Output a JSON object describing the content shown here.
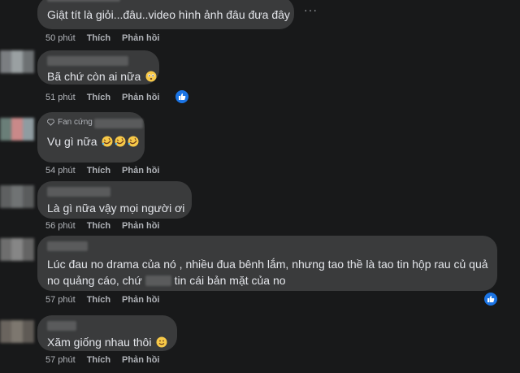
{
  "actions": {
    "like": "Thích",
    "reply": "Phản hồi"
  },
  "more_menu": "···",
  "comments": [
    {
      "text": "Giật tít là giỏi...đâu..video hình ảnh đâu đưa đây",
      "time": "50 phút"
    },
    {
      "text": "Bã chứ còn ai nữa",
      "time": "51 phút"
    },
    {
      "badge": "Fan cứng",
      "text": "Vụ gì nữa",
      "time": "54 phút"
    },
    {
      "text": "Là gì nữa vậy mọi người ơi",
      "time": "56 phút"
    },
    {
      "line1": "Lúc đau no drama của nó , nhiều đua bênh lắm, nhưng tao thề là tao tin hộp rau củ quả",
      "line2a": "no quảng cáo, chứ",
      "line2b": "tin cái bản mặt của no",
      "time": "57 phút"
    },
    {
      "text": "Xăm giống nhau thôi",
      "time": "57 phút"
    }
  ]
}
